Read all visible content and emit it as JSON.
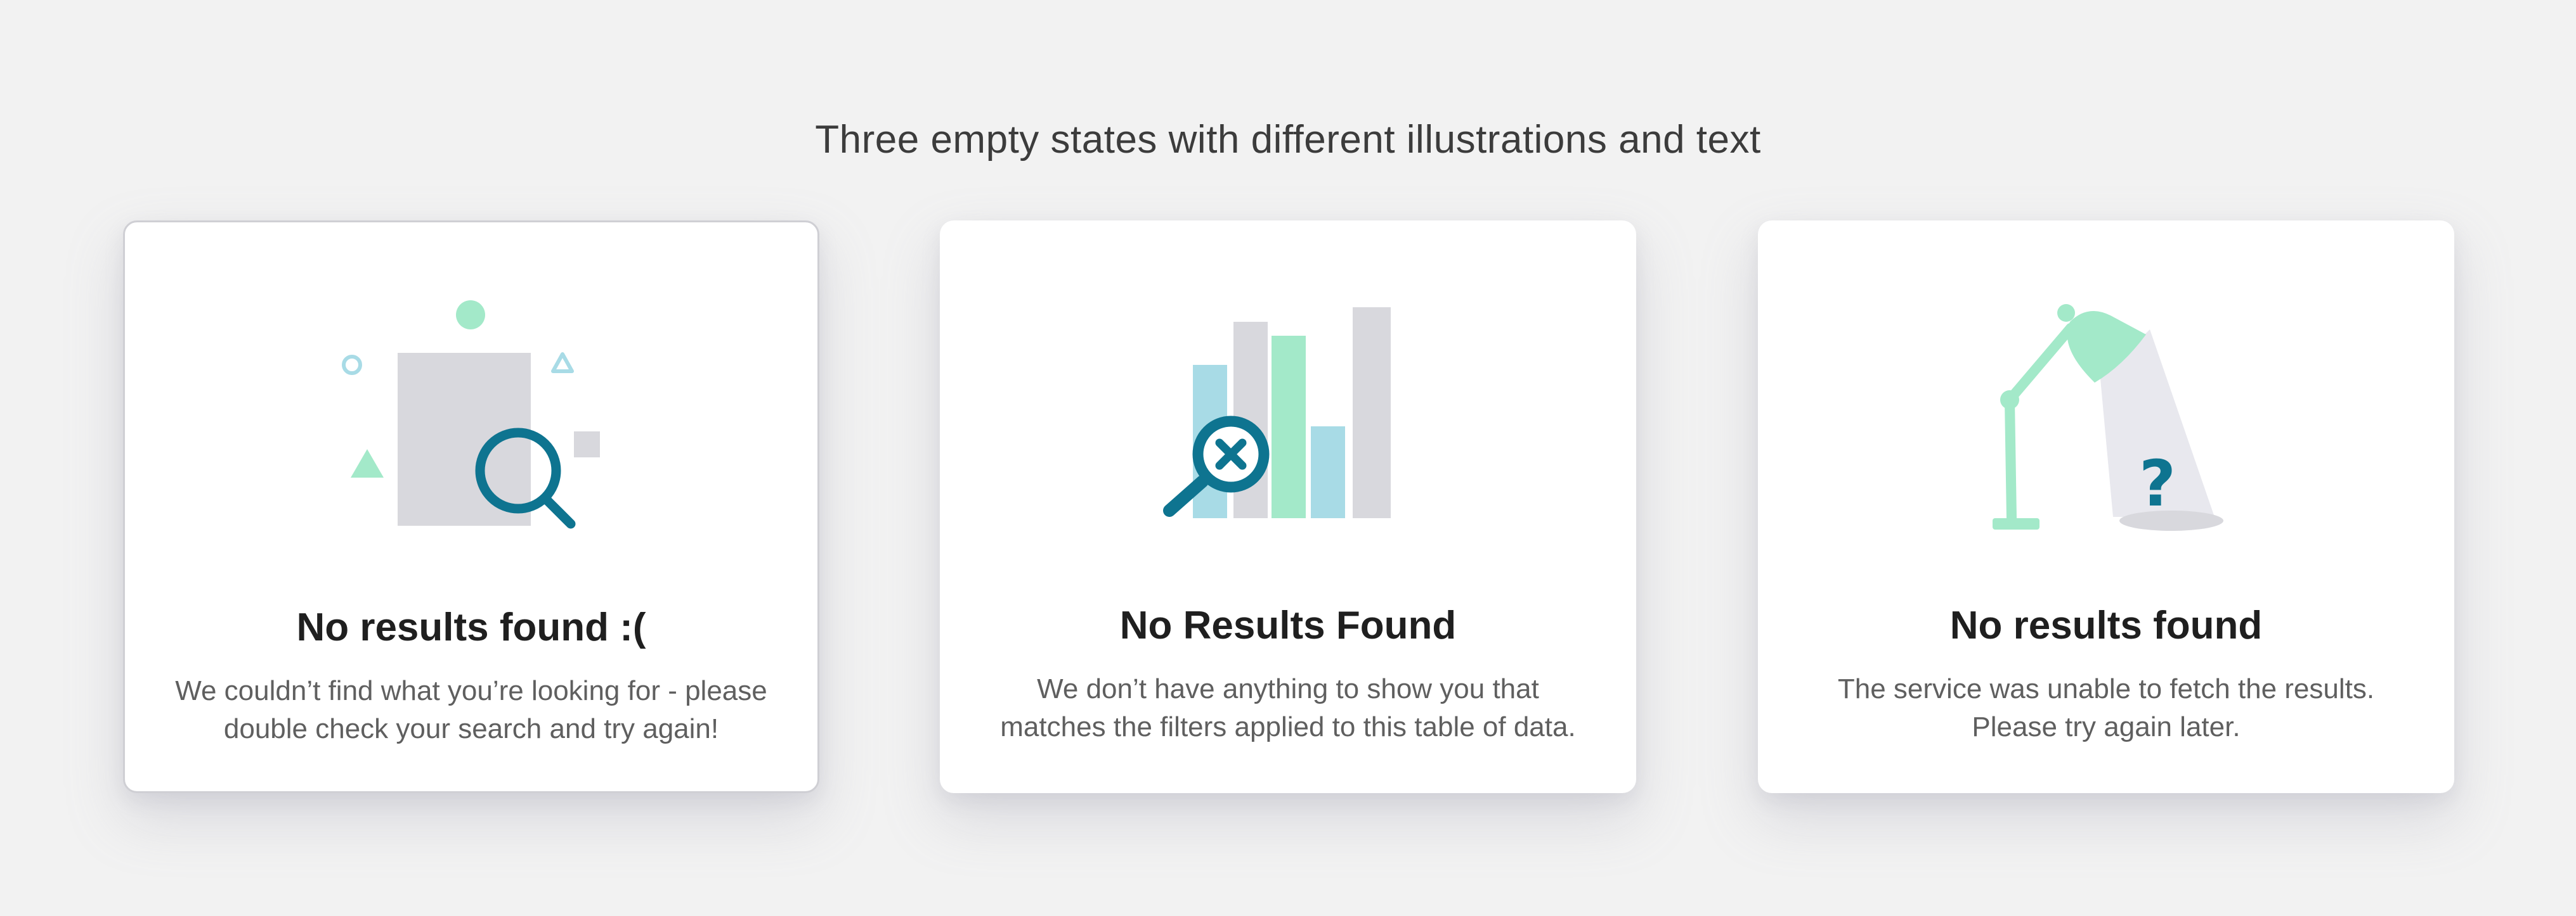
{
  "page": {
    "heading": "Three empty states with different illustrations and text"
  },
  "cards": [
    {
      "title": "No results found :(",
      "line1": "We couldn’t find what you’re looking for - please",
      "line2": "double check your search and try again!",
      "illustration": "search-document-icon"
    },
    {
      "title": "No Results Found",
      "line1": "We don’t have anything to show you that",
      "line2": "matches the filters applied to this table of data.",
      "illustration": "bar-chart-no-match-icon"
    },
    {
      "title": "No results found",
      "line1": "The service was unable to fetch the results.",
      "line2": "Please try again later.",
      "illustration": "desk-lamp-question-icon"
    }
  ],
  "colors": {
    "background": "#f2f2f2",
    "card": "#ffffff",
    "teal": "#0e7490",
    "mint": "#a3e9c9",
    "light-blue": "#a8dbe6",
    "gray": "#d8d8dd"
  }
}
